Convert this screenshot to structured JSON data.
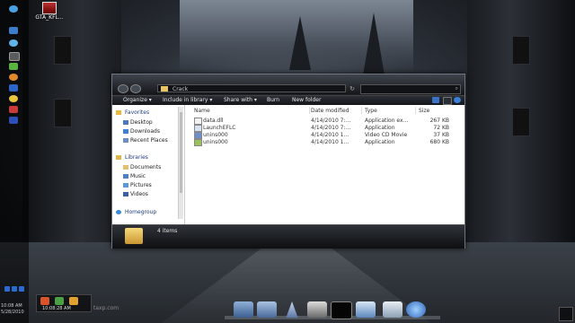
{
  "desktop_icon": {
    "label": "GTA_KFL..."
  },
  "explorer": {
    "address": "Crack",
    "toolbar": {
      "organize": "Organize ▾",
      "include": "Include in library ▾",
      "share": "Share with ▾",
      "burn": "Burn",
      "new_folder": "New folder"
    },
    "nav": {
      "favorites": "Favorites",
      "fav_items": [
        "Desktop",
        "Downloads",
        "Recent Places"
      ],
      "libraries": "Libraries",
      "lib_items": [
        "Documents",
        "Music",
        "Pictures",
        "Videos"
      ],
      "homegroup": "Homegroup"
    },
    "columns": [
      "Name",
      "Date modified",
      "Type",
      "Size"
    ],
    "files": [
      {
        "name": "data.dll",
        "date": "4/14/2010 7:...",
        "type": "Application ex...",
        "size": "267 KB"
      },
      {
        "name": "LaunchEFLC",
        "date": "4/14/2010 7:...",
        "type": "Application",
        "size": "72 KB"
      },
      {
        "name": "unins000",
        "date": "4/14/2010 1...",
        "type": "Video CD Movie",
        "size": "37 KB"
      },
      {
        "name": "unins000",
        "date": "4/14/2010 1...",
        "type": "Application",
        "size": "680 KB"
      }
    ],
    "status": "4 items"
  },
  "taskbar": {
    "time": "10:08 AM",
    "date": "5/28/2010",
    "tray_clock": "10:08:28 AM"
  },
  "watermark": "taxp.com"
}
